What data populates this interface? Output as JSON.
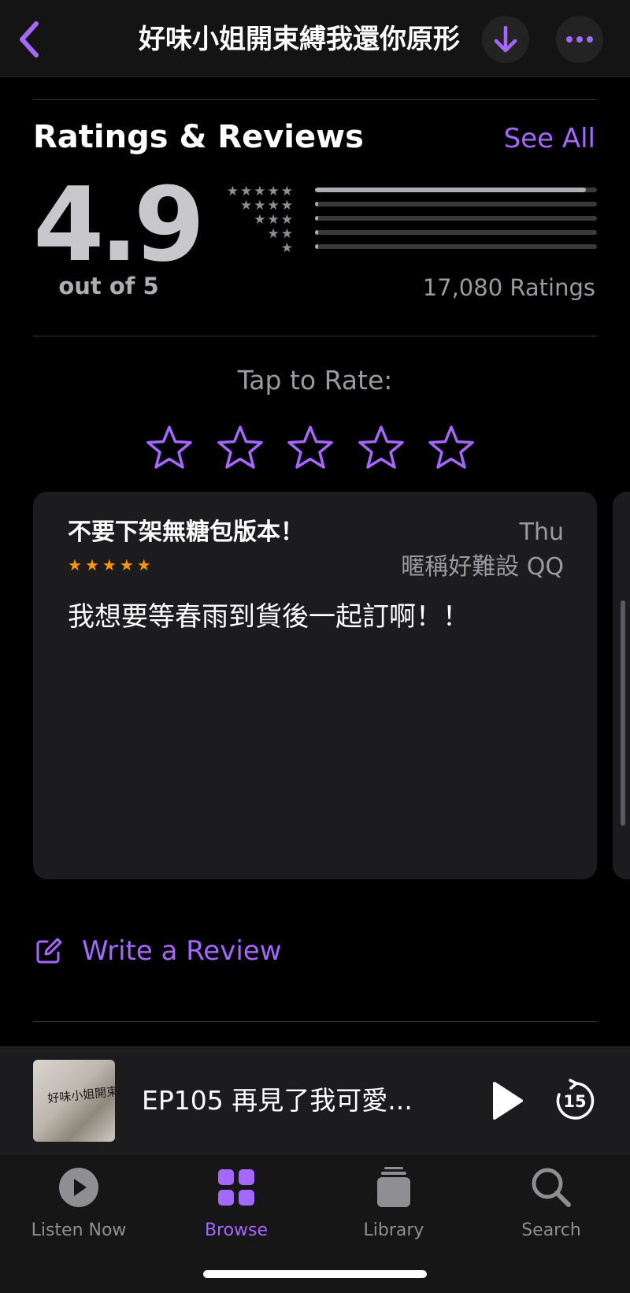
{
  "header": {
    "title": "好味小姐開束縛我還你原形",
    "back_icon": "chevron-left-icon",
    "download_icon": "arrow-down-icon",
    "more_icon": "ellipsis-icon"
  },
  "ratings": {
    "section_title": "Ratings & Reviews",
    "see_all_label": "See All",
    "average": "4.9",
    "out_of_label": "out of 5",
    "count_label": "17,080 Ratings",
    "distribution": [
      {
        "stars": 5,
        "fraction": 0.96
      },
      {
        "stars": 4,
        "fraction": 0.01
      },
      {
        "stars": 3,
        "fraction": 0.01
      },
      {
        "stars": 2,
        "fraction": 0.01
      },
      {
        "stars": 1,
        "fraction": 0.01
      }
    ]
  },
  "tap_to_rate": {
    "label": "Tap to Rate:",
    "star_count": 5
  },
  "review": {
    "title": "不要下架無糖包版本！",
    "date": "Thu",
    "author": "暱稱好難設 QQ",
    "stars": 5,
    "body": "我想要等春雨到貨後一起訂啊！！"
  },
  "write_review": {
    "label": "Write a Review",
    "icon": "compose-icon"
  },
  "now_playing": {
    "episode_title": "EP105 再見了我可愛...",
    "artwork_text": "好味小姐開束縛我還你原型",
    "play_icon": "play-icon",
    "skip_icon": "skip-forward-15-icon",
    "skip_seconds": "15"
  },
  "tabs": [
    {
      "label": "Listen Now",
      "icon": "play-circle-icon",
      "active": false
    },
    {
      "label": "Browse",
      "icon": "grid-icon",
      "active": true
    },
    {
      "label": "Library",
      "icon": "library-stack-icon",
      "active": false
    },
    {
      "label": "Search",
      "icon": "search-icon",
      "active": false
    }
  ],
  "colors": {
    "accent": "#a468ff",
    "star_orange": "#ff9500",
    "background": "#000000",
    "card": "#1c1c1e"
  }
}
